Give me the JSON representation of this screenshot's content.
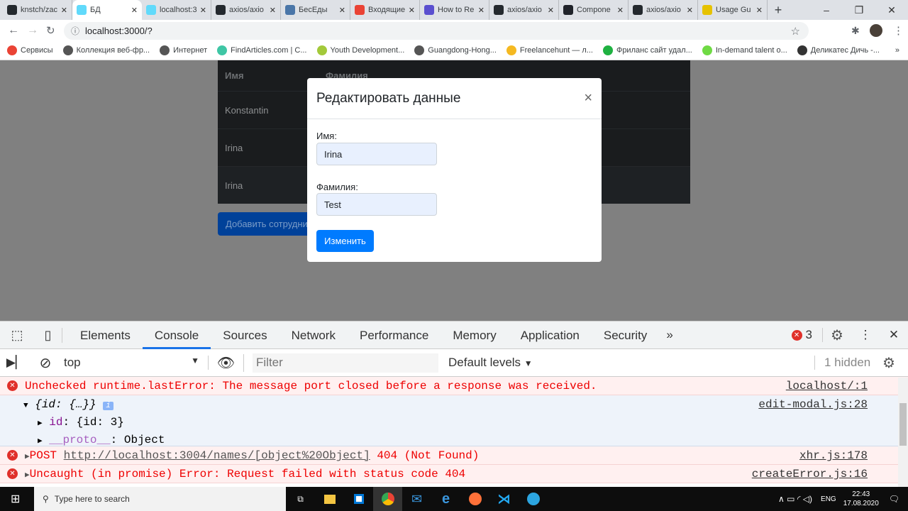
{
  "browser": {
    "tabs": [
      {
        "title": "knstch/zac",
        "icon": "github-icon",
        "color": "#24292e"
      },
      {
        "title": "БД",
        "icon": "react-icon",
        "color": "#61dafb",
        "active": true
      },
      {
        "title": "localhost:3",
        "icon": "react-icon",
        "color": "#61dafb"
      },
      {
        "title": "axios/axio",
        "icon": "github-icon",
        "color": "#24292e"
      },
      {
        "title": "БесЕды",
        "icon": "chat-icon",
        "color": "#4a76a8"
      },
      {
        "title": "Входящие",
        "icon": "gmail-icon",
        "color": "#ea4335"
      },
      {
        "title": "How to Re",
        "icon": "u-icon",
        "color": "#5a4fcf"
      },
      {
        "title": "axios/axio",
        "icon": "github-icon",
        "color": "#24292e"
      },
      {
        "title": "Compone",
        "icon": "react-icon",
        "color": "#20232a"
      },
      {
        "title": "axios/axio",
        "icon": "github-icon",
        "color": "#24292e"
      },
      {
        "title": "Usage Gu",
        "icon": "feather-icon",
        "color": "#e6c200"
      }
    ],
    "url": "localhost:3000/?",
    "bookmarks": [
      {
        "label": "Сервисы",
        "color": "#ea4335"
      },
      {
        "label": "Коллекция веб-фр...",
        "color": "#555"
      },
      {
        "label": "Интернет",
        "color": "#555"
      },
      {
        "label": "FindArticles.com | C...",
        "color": "#3fc6a5"
      },
      {
        "label": "Youth Development...",
        "color": "#a3c93a"
      },
      {
        "label": "Guangdong-Hong...",
        "color": "#555"
      },
      {
        "label": "Freelancehunt — л...",
        "color": "#f5b921"
      },
      {
        "label": "Фриланс сайт удал...",
        "color": "#1fb141"
      },
      {
        "label": "In-demand talent o...",
        "color": "#6fda44"
      },
      {
        "label": "Деликатес Дичь -...",
        "color": "#333"
      }
    ],
    "more_bookmarks": "»"
  },
  "page": {
    "table": {
      "headers": [
        "Имя",
        "Фамилия"
      ],
      "rows": [
        "Konstantin",
        "Irina",
        "Irina"
      ]
    },
    "add_button": "Добавить сотрудника",
    "modal": {
      "title": "Редактировать данные",
      "close": "×",
      "first_name_label": "Имя:",
      "first_name_value": "Irina",
      "last_name_label": "Фамилия:",
      "last_name_value": "Test",
      "submit": "Изменить"
    }
  },
  "devtools": {
    "tabs": [
      "Elements",
      "Console",
      "Sources",
      "Network",
      "Performance",
      "Memory",
      "Application",
      "Security"
    ],
    "active_tab": "Console",
    "more": "»",
    "error_count": "3",
    "context": "top",
    "filter_placeholder": "Filter",
    "levels": "Default levels",
    "hidden": "1 hidden",
    "console": {
      "l1": {
        "text": "Unchecked runtime.lastError: The message port closed before a response was received.",
        "src": "localhost/:1"
      },
      "l2": {
        "obj": "{id: {…}}",
        "src": "edit-modal.js:28",
        "info": "i",
        "prop_key": "id",
        "prop_val": "{id: 3}",
        "proto_key": "__proto__",
        "proto_val": "Object"
      },
      "l3": {
        "method": "POST",
        "url": "http://localhost:3004/names/[object%20Object]",
        "status": "404 (Not Found)",
        "src": "xhr.js:178"
      },
      "l4": {
        "text": "Uncaught (in promise) Error: Request failed with status code 404",
        "src": "createError.js:16"
      }
    }
  },
  "taskbar": {
    "search_placeholder": "Type here to search",
    "time": "22:43",
    "date": "17.08.2020",
    "lang": "ENG"
  }
}
